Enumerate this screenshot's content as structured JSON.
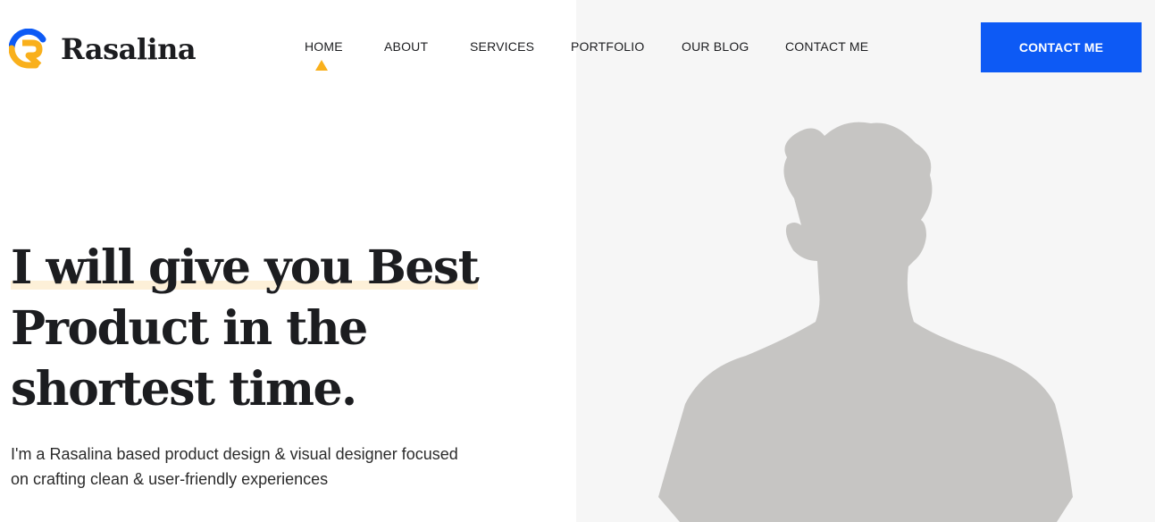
{
  "brand": {
    "name": "Rasalina",
    "logo_icon": "rasalina-logo-icon",
    "accent_color": "#f9b01c",
    "logo_blue": "#0d5af5"
  },
  "nav": {
    "items": [
      {
        "label": "HOME",
        "active": true
      },
      {
        "label": "ABOUT",
        "active": false
      },
      {
        "label": "SERVICES",
        "active": false
      },
      {
        "label": "PORTFOLIO",
        "active": false
      },
      {
        "label": "OUR BLOG",
        "active": false
      },
      {
        "label": "CONTACT ME",
        "active": false
      }
    ]
  },
  "header": {
    "cta_label": "CONTACT ME",
    "cta_color": "#0d5af5"
  },
  "hero": {
    "title_lines": [
      "I will give you Best",
      "Product in the",
      "shortest time."
    ],
    "description": "I'm a Rasalina based product design & visual designer focused on crafting clean & user-friendly experiences",
    "image": "person-silhouette-image",
    "image_color": "#c6c5c3",
    "panel_color": "#f6f6f6"
  }
}
